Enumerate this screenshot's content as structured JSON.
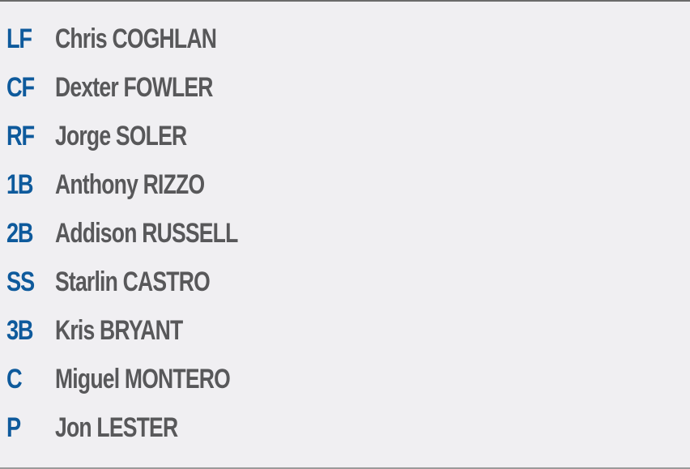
{
  "colors": {
    "background": "#f0eff2",
    "position_text": "#0e5a9c",
    "name_text": "#58585a"
  },
  "lineup": [
    {
      "position": "LF",
      "name": "Chris COGHLAN"
    },
    {
      "position": "CF",
      "name": "Dexter FOWLER"
    },
    {
      "position": "RF",
      "name": "Jorge SOLER"
    },
    {
      "position": "1B",
      "name": "Anthony RIZZO"
    },
    {
      "position": "2B",
      "name": "Addison RUSSELL"
    },
    {
      "position": "SS",
      "name": "Starlin CASTRO"
    },
    {
      "position": "3B",
      "name": "Kris BRYANT"
    },
    {
      "position": "C",
      "name": "Miguel MONTERO"
    },
    {
      "position": "P",
      "name": "Jon LESTER"
    }
  ]
}
